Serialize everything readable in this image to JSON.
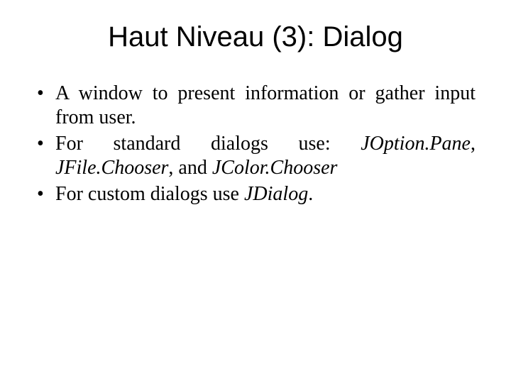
{
  "title": "Haut Niveau (3): Dialog",
  "b1": "A window to present information or gather input from user.",
  "b2a": "For standard dialogs use: ",
  "b2i1": "JOption.Pane",
  "b2b": ", ",
  "b2i2": "JFile.Chooser",
  "b2c": ", and ",
  "b2i3": "JColor.Chooser",
  "b3a": "For custom dialogs use ",
  "b3i1": "JDialog",
  "b3b": "."
}
